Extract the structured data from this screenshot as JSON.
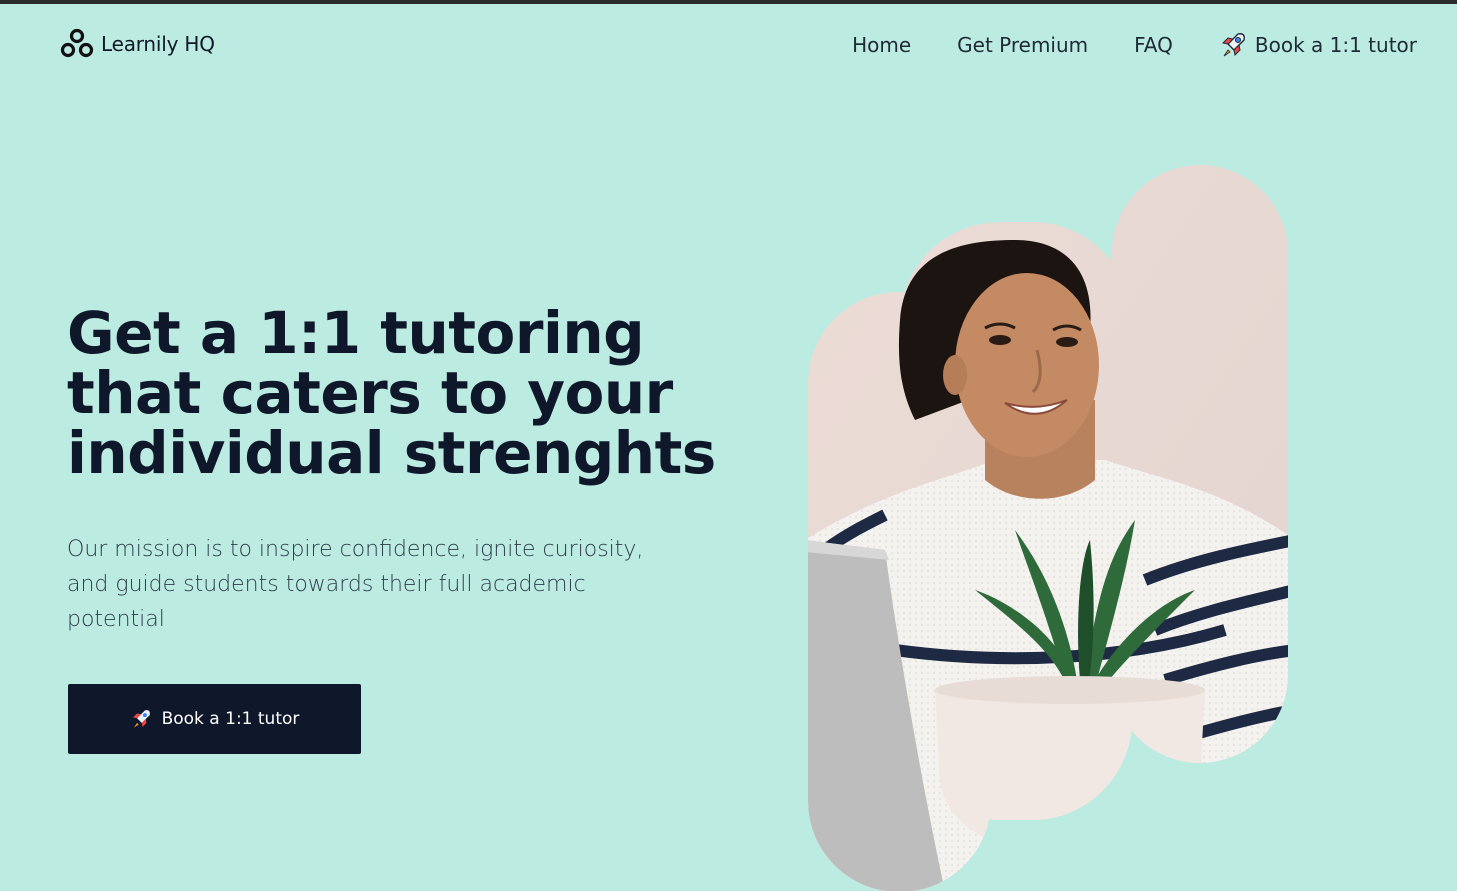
{
  "brand": {
    "name": "Learnily HQ",
    "icon": "three-circles-logo-icon"
  },
  "nav": {
    "items": [
      {
        "label": "Home"
      },
      {
        "label": "Get Premium"
      },
      {
        "label": "FAQ"
      }
    ],
    "cta": {
      "label": "Book a 1:1 tutor",
      "icon": "rocket-icon"
    }
  },
  "hero": {
    "title_lines": [
      "Get a 1:1 tutoring",
      "that caters to your",
      "individual strenghts"
    ],
    "subtitle": "Our mission is to inspire confidence, ignite curiosity, and guide students towards their full academic potential",
    "button": {
      "label": "Book a 1:1 tutor",
      "icon": "rocket-icon"
    },
    "image": {
      "subject": "smiling-student-with-laptop-and-plant"
    }
  },
  "colors": {
    "background": "#bcebe1",
    "text_dark": "#0f172a",
    "button_bg": "#0f172a",
    "button_text": "#ffffff",
    "sweater_stripe": "#1e2a44",
    "plant_green": "#2f6b3a"
  }
}
